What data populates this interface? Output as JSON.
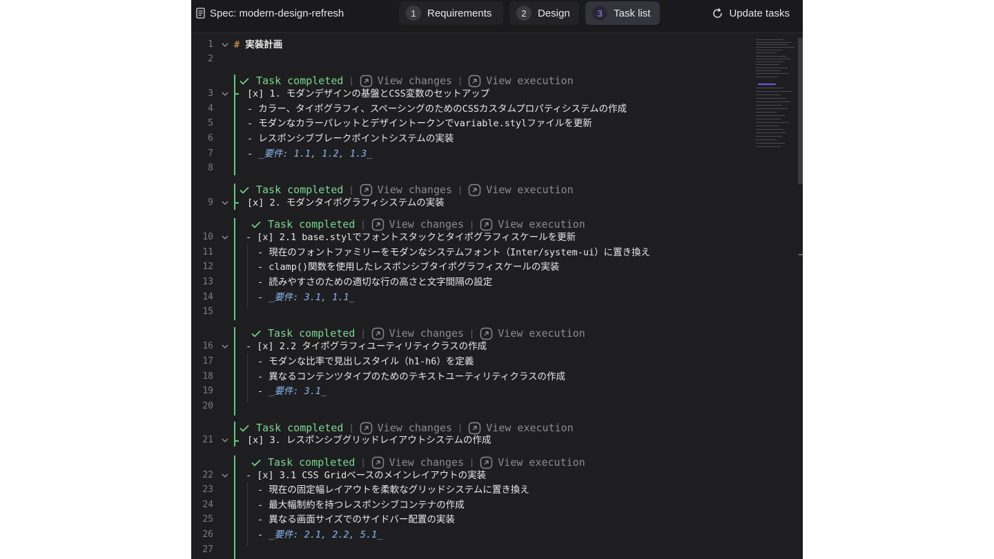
{
  "header": {
    "spec_title": "Spec: modern-design-refresh",
    "tabs": [
      {
        "num": "1",
        "label": "Requirements"
      },
      {
        "num": "2",
        "label": "Design"
      },
      {
        "num": "3",
        "label": "Task list"
      }
    ],
    "update_label": "Update tasks"
  },
  "lens": {
    "completed": "Task completed",
    "view_changes": "View changes",
    "view_execution": "View execution",
    "separator": "|"
  },
  "lines": {
    "l1": {
      "num": "1",
      "text": "実装計画"
    },
    "l2": {
      "num": "2"
    },
    "l3": {
      "num": "3",
      "text": "[x] 1. モダンデザインの基盤とCSS変数のセットアップ"
    },
    "l4": {
      "num": "4",
      "text": "- カラー、タイポグラフィ、スペーシングのためのCSSカスタムプロパティシステムの作成"
    },
    "l5": {
      "num": "5",
      "text": "- モダンなカラーパレットとデザイントークンでvariable.stylファイルを更新"
    },
    "l6": {
      "num": "6",
      "text": "- レスポンシブブレークポイントシステムの実装"
    },
    "l7": {
      "num": "7",
      "prefix": "- ",
      "text": "_要件: 1.1, 1.2, 1.3_"
    },
    "l8": {
      "num": "8"
    },
    "l9": {
      "num": "9",
      "text": "[x] 2. モダンタイポグラフィシステムの実装"
    },
    "l10": {
      "num": "10",
      "text": "- [x] 2.1 base.stylでフォントスタックとタイポグラフィスケールを更新"
    },
    "l11": {
      "num": "11",
      "text": "- 現在のフォントファミリーをモダンなシステムフォント（Inter/system-ui）に置き換え"
    },
    "l12": {
      "num": "12",
      "text": "- clamp()関数を使用したレスポンシブタイポグラフィスケールの実装"
    },
    "l13": {
      "num": "13",
      "text": "- 読みやすさのための適切な行の高さと文字間隔の設定"
    },
    "l14": {
      "num": "14",
      "prefix": "- ",
      "text": "_要件: 3.1, 1.1_"
    },
    "l15": {
      "num": "15"
    },
    "l16": {
      "num": "16",
      "text": "- [x] 2.2 タイポグラフィユーティリティクラスの作成"
    },
    "l17": {
      "num": "17",
      "text": "- モダンな比率で見出しスタイル（h1-h6）を定義"
    },
    "l18": {
      "num": "18",
      "text": "- 異なるコンテンツタイプのためのテキストユーティリティクラスの作成"
    },
    "l19": {
      "num": "19",
      "prefix": "- ",
      "text": "_要件: 3.1_"
    },
    "l20": {
      "num": "20"
    },
    "l21": {
      "num": "21",
      "text": "[x] 3. レスポンシブグリッドレイアウトシステムの作成"
    },
    "l22": {
      "num": "22",
      "text": "- [x] 3.1 CSS Gridベースのメインレイアウトの実装"
    },
    "l23": {
      "num": "23",
      "text": "- 現在の固定幅レイアウトを柔軟なグリッドシステムに置き換え"
    },
    "l24": {
      "num": "24",
      "text": "- 最大幅制約を持つレスポンシブコンテナの作成"
    },
    "l25": {
      "num": "25",
      "text": "- 異なる画面サイズでのサイドバー配置の実装"
    },
    "l26": {
      "num": "26",
      "prefix": "- ",
      "text": "_要件: 2.1, 2.2, 5.1_"
    },
    "l27": {
      "num": "27"
    }
  },
  "heading_mark": "#",
  "colors": {
    "background": "#1e1e21",
    "completed": "#7bd88f",
    "gutter_bar": "#5fcf7a",
    "requirement_text": "#8ab8f0",
    "heading_mark": "#e8a04c",
    "active_tab_number": "#b08cff"
  }
}
